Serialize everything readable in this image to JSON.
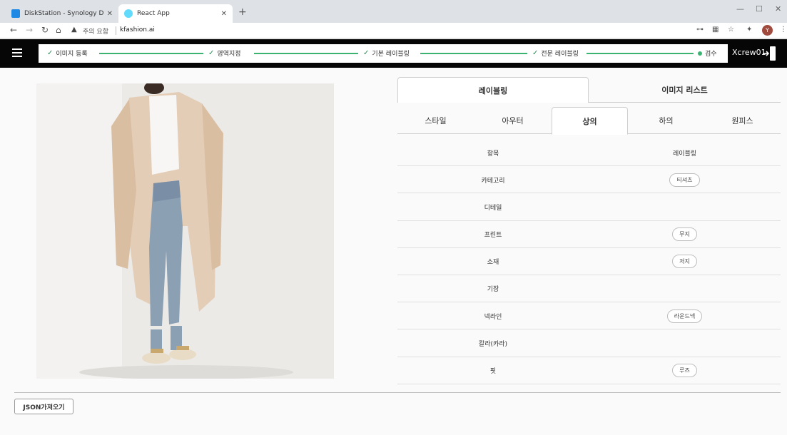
{
  "browser": {
    "tabs": [
      {
        "title": "DiskStation - Synology DiskStati",
        "favicon_color": "#1e88e5"
      },
      {
        "title": "React App",
        "favicon_color": "#61dafb"
      }
    ],
    "new_tab": "+",
    "address": {
      "warning": "주의 요함",
      "url": "kfashion.ai"
    },
    "profile_initial": "Y"
  },
  "app": {
    "steps": [
      {
        "label": "이미지 등록",
        "state": "done"
      },
      {
        "label": "영역지정",
        "state": "done"
      },
      {
        "label": "기본 레이블링",
        "state": "done"
      },
      {
        "label": "전문 레이블링",
        "state": "done"
      },
      {
        "label": "검수",
        "state": "current"
      }
    ],
    "user": "Xcrew01",
    "accent_color": "#3cb371"
  },
  "panel": {
    "top_tabs": [
      "레이블링",
      "이미지 리스트"
    ],
    "sub_tabs": [
      "스타일",
      "아우터",
      "상의",
      "하의",
      "원피스"
    ],
    "table": {
      "headers": [
        "항목",
        "레이블링"
      ],
      "rows": [
        {
          "item": "카테고리",
          "value": "티셔츠"
        },
        {
          "item": "디테일",
          "value": ""
        },
        {
          "item": "프린트",
          "value": "무지"
        },
        {
          "item": "소재",
          "value": "저지"
        },
        {
          "item": "기장",
          "value": ""
        },
        {
          "item": "넥라인",
          "value": "라운드넥"
        },
        {
          "item": "칼라(카라)",
          "value": ""
        },
        {
          "item": "핏",
          "value": "루즈"
        }
      ]
    }
  },
  "footer": {
    "json_button": "JSON가져오기"
  }
}
